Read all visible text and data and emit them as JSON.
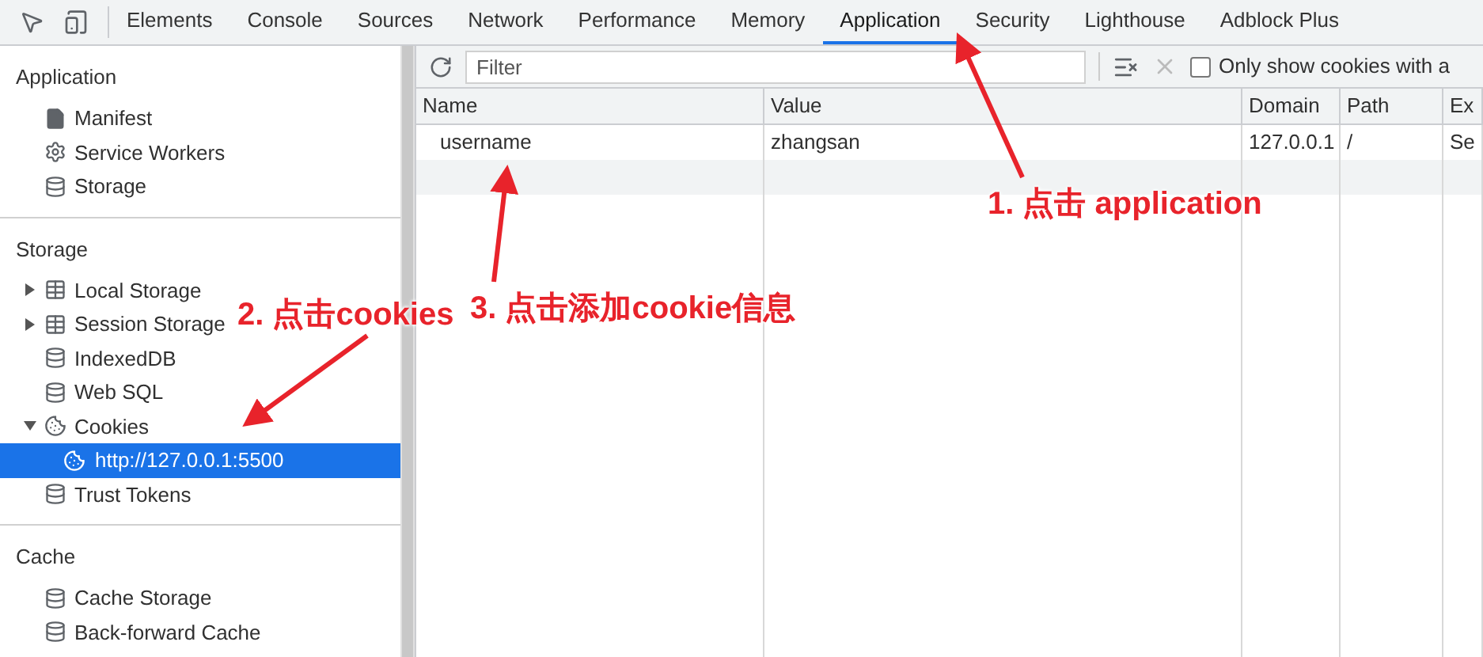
{
  "tabs": [
    {
      "label": "Elements",
      "selected": false
    },
    {
      "label": "Console",
      "selected": false
    },
    {
      "label": "Sources",
      "selected": false
    },
    {
      "label": "Network",
      "selected": false
    },
    {
      "label": "Performance",
      "selected": false
    },
    {
      "label": "Memory",
      "selected": false
    },
    {
      "label": "Application",
      "selected": true
    },
    {
      "label": "Security",
      "selected": false
    },
    {
      "label": "Lighthouse",
      "selected": false
    },
    {
      "label": "Adblock Plus",
      "selected": false
    }
  ],
  "sidebar": {
    "sections": [
      {
        "title": "Application",
        "items": [
          {
            "label": "Manifest",
            "selected": false
          },
          {
            "label": "Service Workers",
            "selected": false
          },
          {
            "label": "Storage",
            "selected": false
          }
        ]
      },
      {
        "title": "Storage",
        "items": [
          {
            "label": "Local Storage",
            "selected": false,
            "expanded": false
          },
          {
            "label": "Session Storage",
            "selected": false,
            "expanded": false
          },
          {
            "label": "IndexedDB",
            "selected": false
          },
          {
            "label": "Web SQL",
            "selected": false
          },
          {
            "label": "Cookies",
            "selected": false,
            "expanded": true,
            "children": [
              {
                "label": "http://127.0.0.1:5500",
                "selected": true
              }
            ]
          },
          {
            "label": "Trust Tokens",
            "selected": false
          }
        ]
      },
      {
        "title": "Cache",
        "items": [
          {
            "label": "Cache Storage",
            "selected": false
          },
          {
            "label": "Back-forward Cache",
            "selected": false
          }
        ]
      }
    ]
  },
  "toolbar": {
    "filter": {
      "placeholder": "Filter"
    },
    "only_issues": {
      "label": "Only show cookies with a",
      "checked": false
    }
  },
  "table": {
    "columns": [
      "Name",
      "Value",
      "Domain",
      "Path",
      "Ex"
    ],
    "rows": [
      [
        "username",
        "zhangsan",
        "127.0.0.1",
        "/",
        "Se"
      ]
    ]
  },
  "annotations": [
    {
      "text": "1. 点击 application"
    },
    {
      "text": "2. 点击cookies"
    },
    {
      "text": "3. 点击添加cookie信息"
    }
  ]
}
